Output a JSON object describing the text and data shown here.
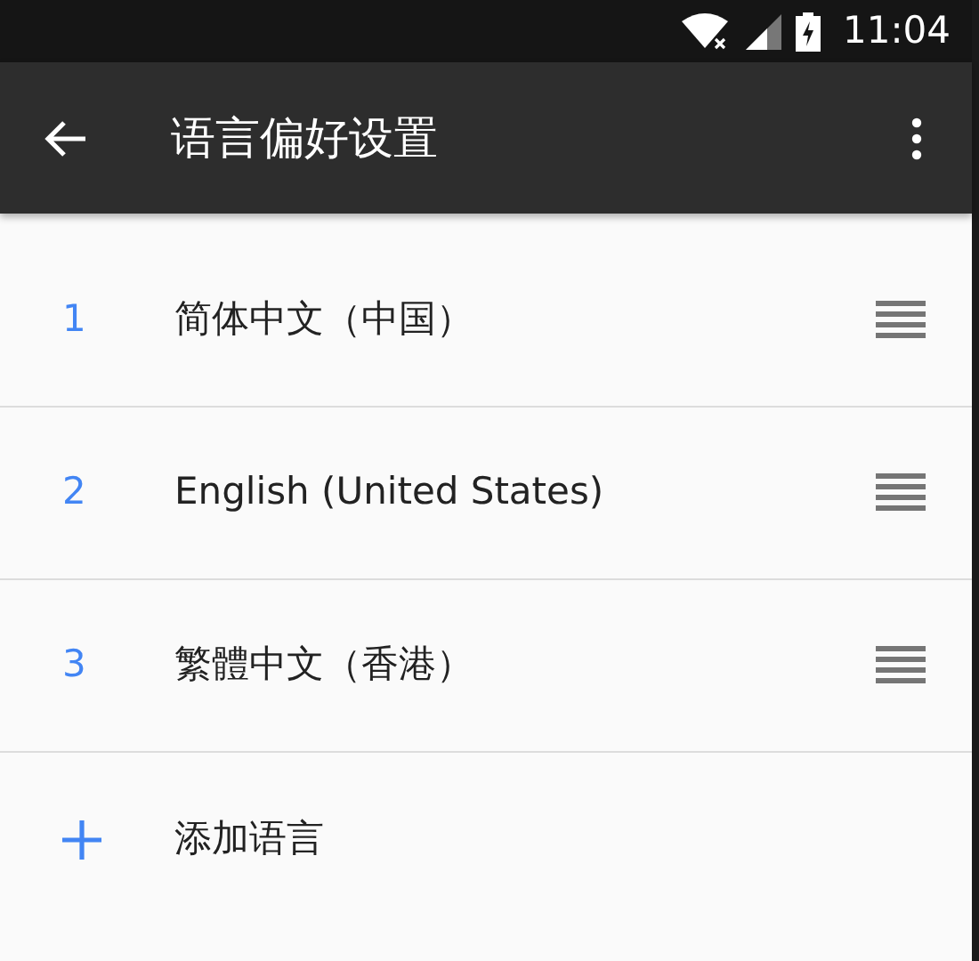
{
  "status_bar": {
    "time": "11:04"
  },
  "app_bar": {
    "title": "语言偏好设置"
  },
  "languages": [
    {
      "number": "1",
      "name": "简体中文（中国）"
    },
    {
      "number": "2",
      "name": "English (United States)"
    },
    {
      "number": "3",
      "name": "繁體中文（香港）"
    }
  ],
  "add_row": {
    "label": "添加语言"
  }
}
